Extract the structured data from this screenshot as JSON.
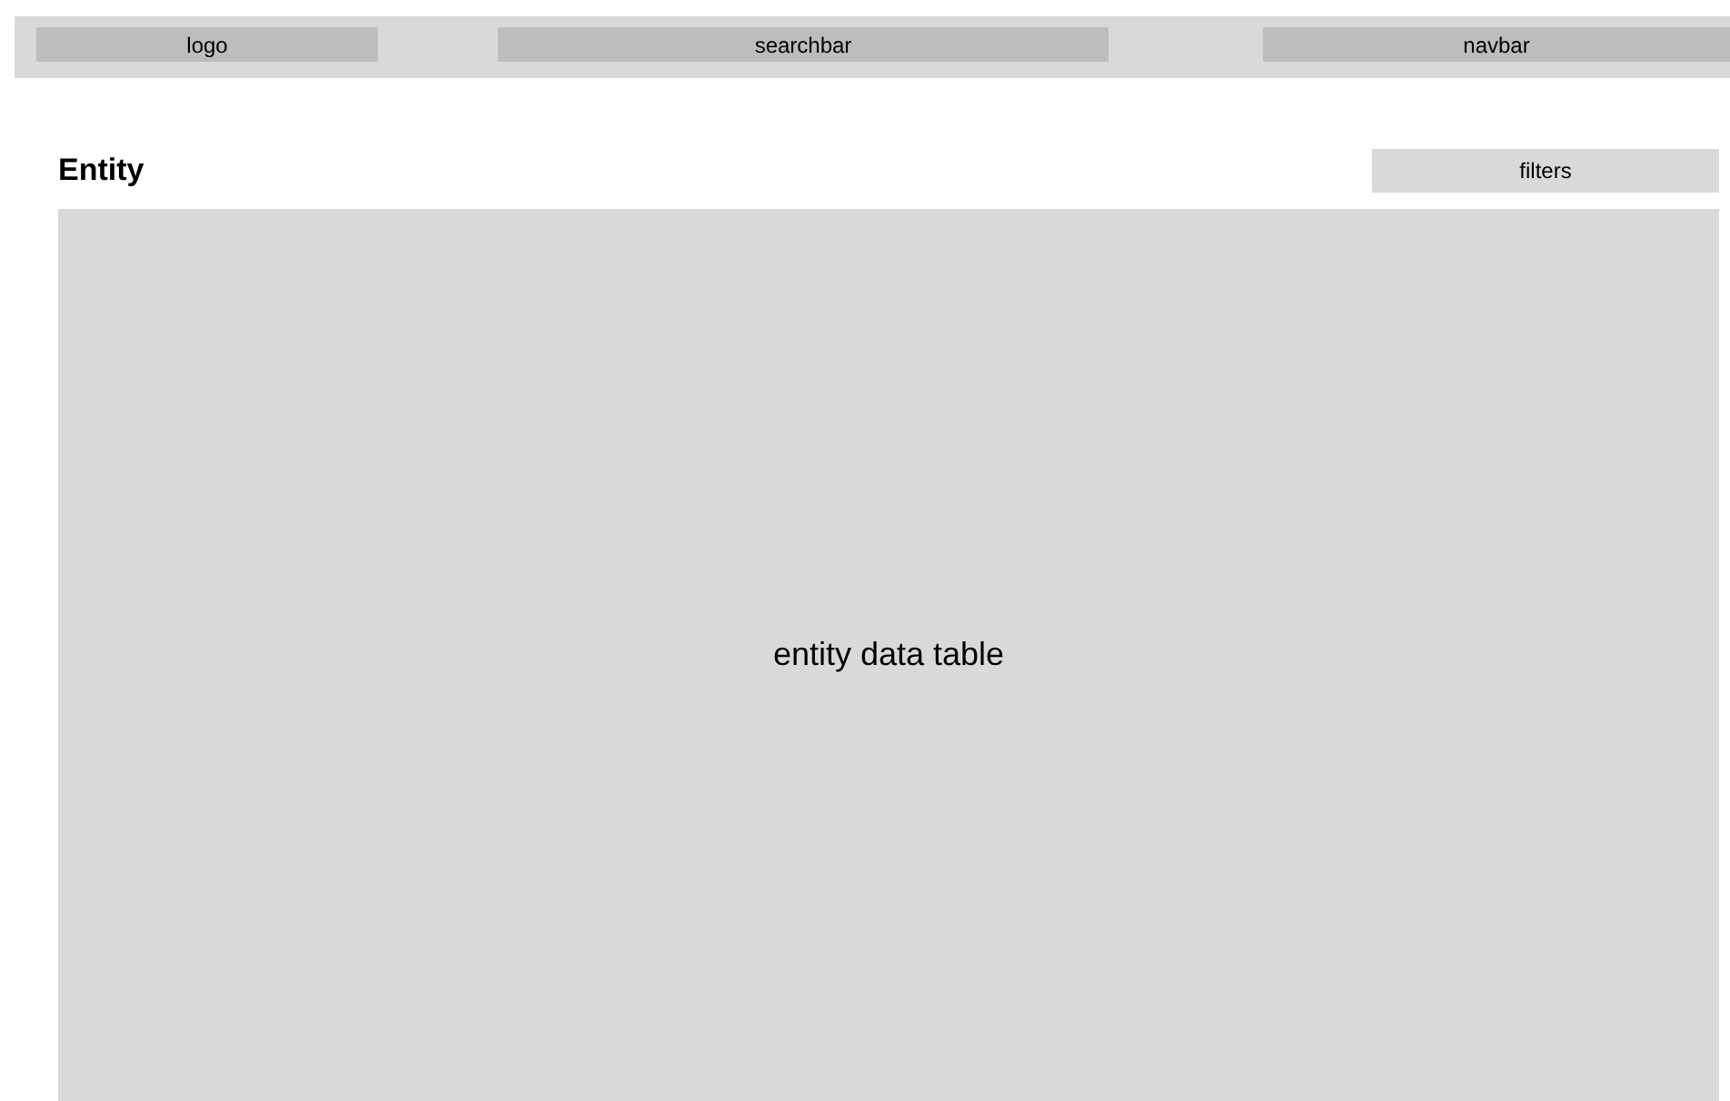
{
  "header": {
    "logo": "logo",
    "searchbar": "searchbar",
    "navbar": "navbar"
  },
  "page": {
    "title": "Entity",
    "filters": "filters",
    "table": "entity data table"
  }
}
